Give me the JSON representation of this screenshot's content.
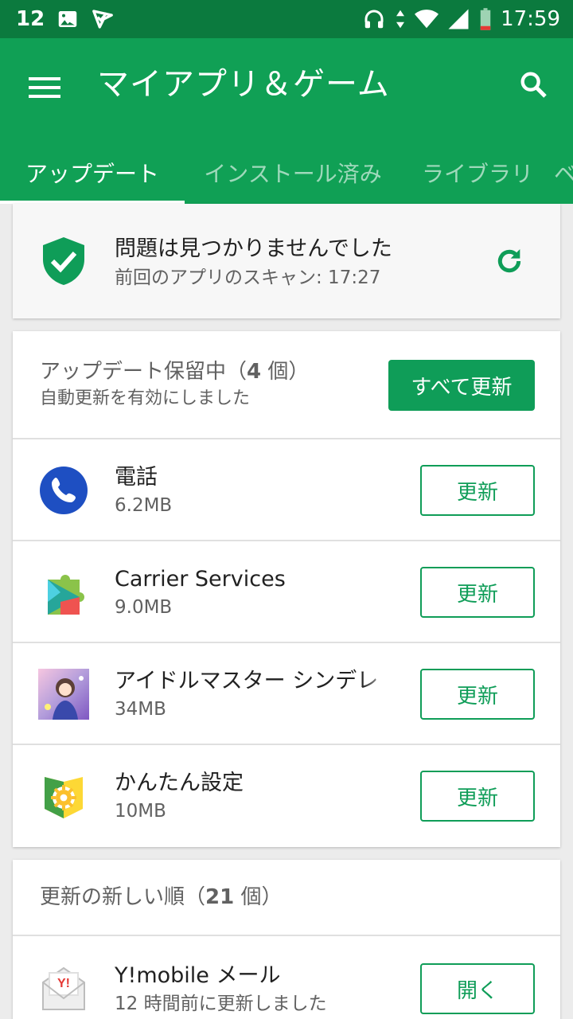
{
  "status_bar": {
    "notification_count": "12",
    "time": "17:59",
    "icons": [
      "image-icon",
      "check-notification-icon",
      "headphones-icon",
      "data-arrows-icon",
      "wifi-icon",
      "signal-icon",
      "battery-low-icon"
    ]
  },
  "app_bar": {
    "title": "マイアプリ＆ゲーム",
    "menu_icon": "menu-icon",
    "search_icon": "search-icon"
  },
  "tabs": [
    {
      "label": "アップデート",
      "active": true
    },
    {
      "label": "インストール済み",
      "active": false
    },
    {
      "label": "ライブラリ",
      "active": false
    },
    {
      "label": "ベ",
      "active": false
    }
  ],
  "scan": {
    "title": "問題は見つかりませんでした",
    "subtitle": "前回のアプリのスキャン: 17:27",
    "icon": "shield-check-icon",
    "refresh_icon": "refresh-icon"
  },
  "pending": {
    "title_prefix": "アップデート保留中（",
    "count": "4",
    "title_suffix": " 個）",
    "subtitle": "自動更新を有効にしました",
    "update_all_label": "すべて更新"
  },
  "apps": [
    {
      "name": "電話",
      "size": "6.2MB",
      "button": "更新",
      "icon": "phone-app-icon"
    },
    {
      "name": "Carrier Services",
      "size": "9.0MB",
      "button": "更新",
      "icon": "carrier-services-icon"
    },
    {
      "name": "アイドルマスター シンデレ",
      "size": "34MB",
      "button": "更新",
      "icon": "idolmaster-icon"
    },
    {
      "name": "かんたん設定",
      "size": "10MB",
      "button": "更新",
      "icon": "easy-settings-icon"
    }
  ],
  "recent": {
    "title_prefix": "更新の新しい順（",
    "count": "21",
    "title_suffix": " 個）",
    "items": [
      {
        "name": "Y!mobile メール",
        "subtitle": "12 時間前に更新しました",
        "button": "開く",
        "icon": "ymobile-mail-icon"
      }
    ]
  },
  "colors": {
    "status_bar": "#0b7a3e",
    "app_bar": "#10a055",
    "accent": "#0f9d58"
  }
}
